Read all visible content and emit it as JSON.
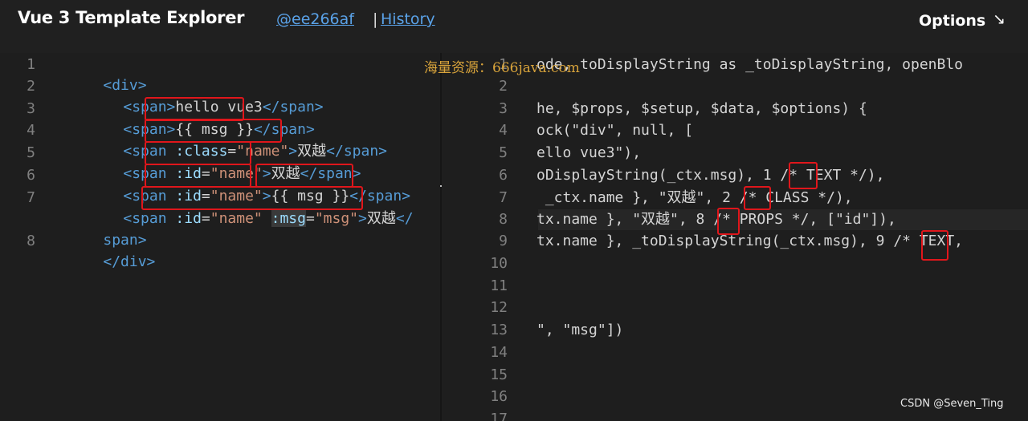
{
  "header": {
    "title": "Vue 3 Template Explorer",
    "commit": "@ee266af",
    "separator": "|",
    "history": "History",
    "options": "Options",
    "options_icon": "↘"
  },
  "left_editor": {
    "line_numbers": [
      "1",
      "2",
      "3",
      "4",
      "5",
      "6",
      "7",
      "8"
    ],
    "lines": [
      [
        "<div>"
      ],
      [
        "<span>",
        "hello vue3",
        "</span>"
      ],
      [
        "<span>",
        "{{ msg }}",
        "</span>"
      ],
      [
        "<span ",
        ":class",
        "=",
        "\"name\"",
        ">",
        "双越",
        "</span>"
      ],
      [
        "<span ",
        ":id",
        "=",
        "\"name\"",
        ">",
        "双越",
        "</span>"
      ],
      [
        "<span ",
        ":id",
        "=",
        "\"name\"",
        ">",
        "{{ msg }}",
        "</span>"
      ],
      [
        "<span ",
        ":id",
        "=",
        "\"name\"",
        " ",
        ":msg",
        "=",
        "\"msg\"",
        ">",
        "双越",
        "</"
      ],
      [
        "span>"
      ],
      [
        "</div>"
      ]
    ]
  },
  "right_editor": {
    "line_numbers": [
      "1",
      "2",
      "3",
      "4",
      "5",
      "6",
      "7",
      "8",
      "9",
      "10",
      "11",
      "12",
      "13",
      "14",
      "15",
      "16",
      "17"
    ],
    "lines": [
      "ode, toDisplayString as _toDisplayString, openBlo",
      "",
      "he, $props, $setup, $data, $options) {",
      "ock(\"div\", null, [",
      "ello vue3\"),",
      "oDisplayString(_ctx.msg), 1 /* TEXT */),",
      " _ctx.name }, \"双越\", 2 /* CLASS */),",
      "tx.name }, \"双越\", 8 /* PROPS */, [\"id\"]),",
      "tx.name }, _toDisplayString(_ctx.msg), 9 /* TEXT,",
      "",
      "",
      "",
      "\", \"msg\"])",
      "",
      "",
      "",
      ""
    ]
  },
  "watermark": "海量资源：666java.com",
  "credit": "CSDN @Seven_Ting"
}
